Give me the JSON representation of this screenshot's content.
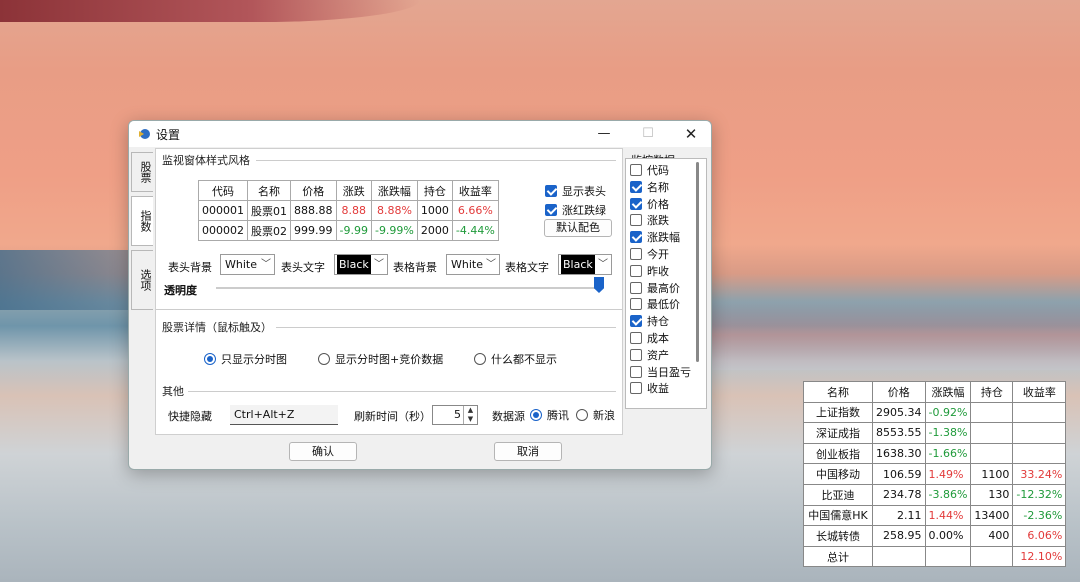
{
  "window": {
    "title": "设置",
    "minimize": "—",
    "maximize": "☐",
    "close": "✕"
  },
  "tabs": [
    "股票",
    "指数",
    "选项"
  ],
  "style_group": {
    "title": "监视窗体样式风格",
    "preview": {
      "headers": [
        "代码",
        "名称",
        "价格",
        "涨跌",
        "涨跌幅",
        "持仓",
        "收益率"
      ],
      "rows": [
        [
          "000001",
          "股票01",
          "888.88",
          "8.88",
          "8.88%",
          "1000",
          "6.66%"
        ],
        [
          "000002",
          "股票02",
          "999.99",
          "-9.99",
          "-9.99%",
          "2000",
          "-4.44%"
        ]
      ]
    },
    "show_header": "显示表头",
    "red_up_green_down": "涨红跌绿",
    "default_colors": "默认配色",
    "header_bg_label": "表头背景",
    "header_bg_value": "White",
    "header_text_label": "表头文字",
    "header_text_value": "Black",
    "table_bg_label": "表格背景",
    "table_bg_value": "White",
    "table_text_label": "表格文字",
    "table_text_value": "Black",
    "opacity_label": "透明度",
    "opacity_value": 1.0
  },
  "details_group": {
    "title": "股票详情（鼠标触及）",
    "options": [
      "只显示分时图",
      "显示分时图+竞价数据",
      "什么都不显示"
    ],
    "selected": 0
  },
  "other_group": {
    "title": "其他",
    "hotkey_label": "快捷隐藏",
    "hotkey_value": "Ctrl+Alt+Z",
    "refresh_label": "刷新时间（秒）",
    "refresh_value": "5",
    "source_label": "数据源",
    "sources": [
      "腾讯",
      "新浪"
    ],
    "source_selected": 0
  },
  "monitor_fields": {
    "title": "监控数据",
    "items": [
      {
        "label": "代码",
        "checked": false
      },
      {
        "label": "名称",
        "checked": true
      },
      {
        "label": "价格",
        "checked": true
      },
      {
        "label": "涨跌",
        "checked": false
      },
      {
        "label": "涨跌幅",
        "checked": true
      },
      {
        "label": "今开",
        "checked": false
      },
      {
        "label": "昨收",
        "checked": false
      },
      {
        "label": "最高价",
        "checked": false
      },
      {
        "label": "最低价",
        "checked": false
      },
      {
        "label": "持仓",
        "checked": true
      },
      {
        "label": "成本",
        "checked": false
      },
      {
        "label": "资产",
        "checked": false
      },
      {
        "label": "当日盈亏",
        "checked": false
      },
      {
        "label": "收益",
        "checked": false
      }
    ]
  },
  "buttons": {
    "ok": "确认",
    "cancel": "取消"
  },
  "monitor_table": {
    "headers": [
      "名称",
      "价格",
      "涨跌幅",
      "持仓",
      "收益率"
    ],
    "rows": [
      [
        "上证指数",
        "2905.34",
        "-0.92%",
        "",
        ""
      ],
      [
        "深证成指",
        "8553.55",
        "-1.38%",
        "",
        ""
      ],
      [
        "创业板指",
        "1638.30",
        "-1.66%",
        "",
        ""
      ],
      [
        "中国移动",
        "106.59",
        "1.49%",
        "1100",
        "33.24%"
      ],
      [
        "比亚迪",
        "234.78",
        "-3.86%",
        "130",
        "-12.32%"
      ],
      [
        "中国儒意HK",
        "2.11",
        "1.44%",
        "13400",
        "-2.36%"
      ],
      [
        "长城转债",
        "258.95",
        "0.00%",
        "400",
        "6.06%"
      ],
      [
        "总计",
        "",
        "",
        "",
        "12.10%"
      ]
    ]
  },
  "colors": {
    "accent": "#1a63c9",
    "up": "#e23a3a",
    "down": "#1f9a3a"
  }
}
